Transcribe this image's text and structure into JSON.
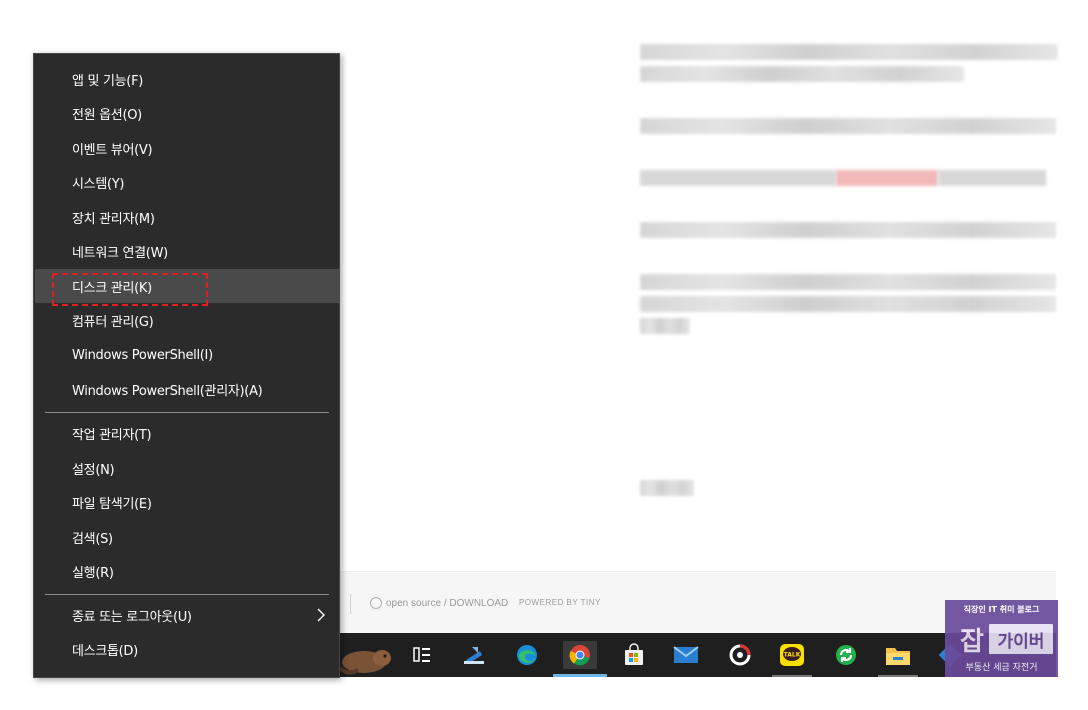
{
  "menu": {
    "items_group1": [
      {
        "label": "앱 및 기능(F)",
        "name": "menu-item-apps-features"
      },
      {
        "label": "전원 옵션(O)",
        "name": "menu-item-power-options"
      },
      {
        "label": "이벤트 뷰어(V)",
        "name": "menu-item-event-viewer"
      },
      {
        "label": "시스템(Y)",
        "name": "menu-item-system"
      },
      {
        "label": "장치 관리자(M)",
        "name": "menu-item-device-manager"
      },
      {
        "label": "네트워크 연결(W)",
        "name": "menu-item-network-connections"
      },
      {
        "label": "디스크 관리(K)",
        "name": "menu-item-disk-management"
      },
      {
        "label": "컴퓨터 관리(G)",
        "name": "menu-item-computer-management"
      },
      {
        "label": "Windows PowerShell(I)",
        "name": "menu-item-powershell"
      },
      {
        "label": "Windows PowerShell(관리자)(A)",
        "name": "menu-item-powershell-admin"
      }
    ],
    "items_group2": [
      {
        "label": "작업 관리자(T)",
        "name": "menu-item-task-manager"
      },
      {
        "label": "설정(N)",
        "name": "menu-item-settings"
      },
      {
        "label": "파일 탐색기(E)",
        "name": "menu-item-file-explorer"
      },
      {
        "label": "검색(S)",
        "name": "menu-item-search"
      },
      {
        "label": "실행(R)",
        "name": "menu-item-run"
      }
    ],
    "items_group3": [
      {
        "label": "종료 또는 로그아웃(U)",
        "name": "menu-item-shutdown-signout",
        "has_submenu": true
      },
      {
        "label": "데스크톱(D)",
        "name": "menu-item-desktop"
      }
    ],
    "hovered_item": "디스크 관리(K)",
    "highlight_color": "#e02020"
  },
  "footer": {
    "open_source": "open source / DOWNLOAD",
    "powered_by": "POWERED BY TINY"
  },
  "taskbar": {
    "icons": [
      "task-view-icon",
      "remote-desktop-icon",
      "edge-icon",
      "chrome-icon",
      "store-icon",
      "mail-icon",
      "screen-recorder-icon",
      "kakaotalk-icon",
      "sync-icon",
      "file-explorer-icon",
      "app-icon"
    ],
    "kakaotalk_label": "TALK"
  },
  "watermark": {
    "tagline": "직장인 IT 취미 블로그",
    "big_char": "잡",
    "name": "가이버",
    "sub": "부동산 세금 자전거"
  },
  "colors": {
    "menu_bg": "#2b2b2b",
    "menu_hover": "#4a4a4a",
    "taskbar_bg": "#1f1f1f",
    "watermark_bg": "#6a4a9a"
  }
}
